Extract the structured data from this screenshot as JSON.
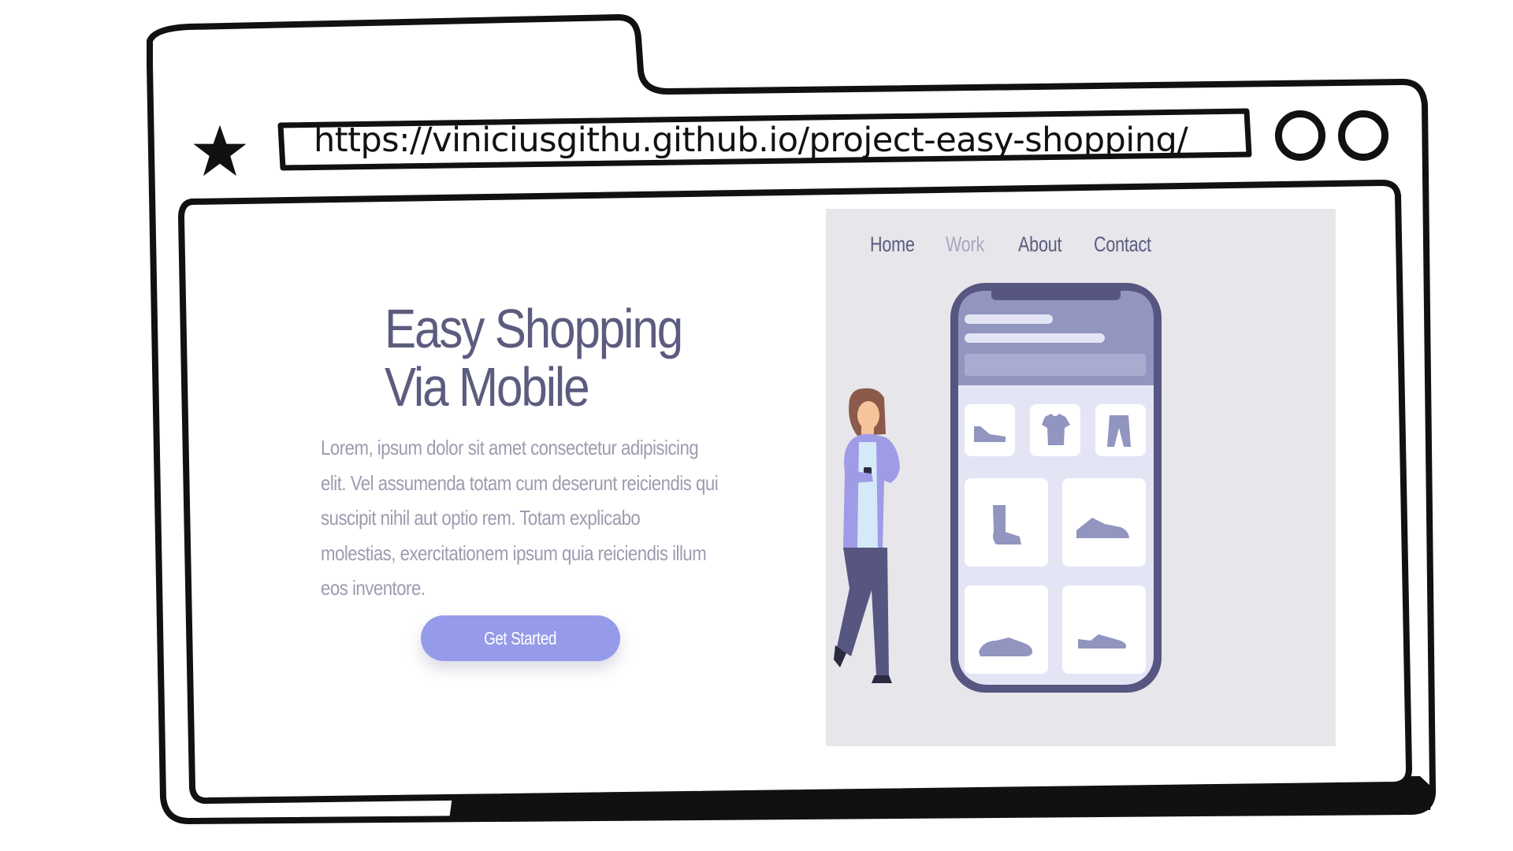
{
  "browser": {
    "url": "https://viniciusgithu.github.io/project-easy-shopping/",
    "bookmark_icon": "star-icon",
    "window_buttons": [
      "circle-button",
      "circle-button"
    ]
  },
  "hero": {
    "title_line1": "Easy Shopping",
    "title_line2": "Via Mobile",
    "body": "Lorem, ipsum dolor sit amet consectetur adipisicing elit. Vel assumenda totam cum deserunt reiciendis qui suscipit nihil aut optio rem. Totam explicabo molestias, exercitationem ipsum quia reiciendis illum eos inventore.",
    "cta_label": "Get Started"
  },
  "nav": {
    "items": [
      {
        "label": "Home"
      },
      {
        "label": "Work"
      },
      {
        "label": "About"
      },
      {
        "label": "Contact"
      }
    ],
    "active_color": "#5c5c7f",
    "muted_color": "#a7a8c0"
  },
  "colors": {
    "accent": "#959be8",
    "title": "#5c5c7f",
    "text": "#9c9cb0",
    "panel_bg": "#e7e6eb",
    "phone_frame": "#575680"
  }
}
